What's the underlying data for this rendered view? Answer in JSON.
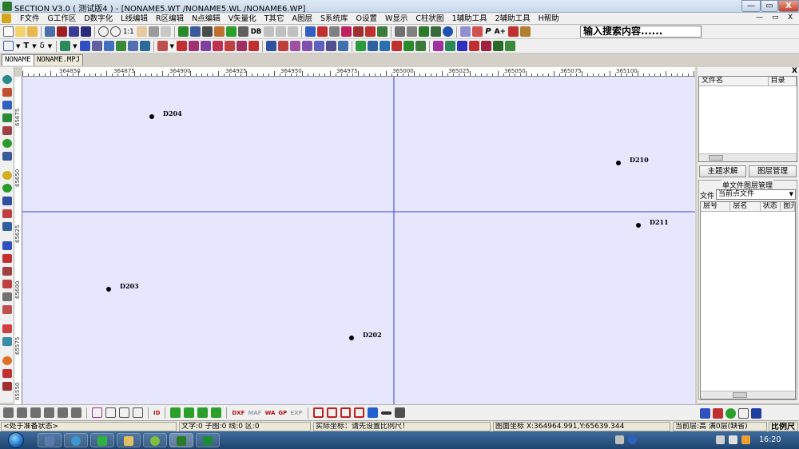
{
  "window": {
    "title": "SECTION V3.0 ( 测试版4 ) - [NONAME5.WT /NONAME5.WL /NONAME6.WP]",
    "min_label": "—",
    "max_label": "▭",
    "close_label": "X"
  },
  "menu": {
    "items": [
      "F文件",
      "G工作区",
      "D数字化",
      "L线编辑",
      "R区编辑",
      "N点编辑",
      "V矢量化",
      "T其它",
      "A图层",
      "S系统库",
      "O设置",
      "W显示",
      "C柱状图",
      "1辅助工具",
      "2辅助工具",
      "H帮助"
    ],
    "mdi_min": "—",
    "mdi_restore": "▭",
    "mdi_close": "X"
  },
  "toolbar1": {
    "zoom_label": "1:1",
    "db_label": "DB",
    "p_label": "P",
    "a_label": "A+",
    "search_value": "输入搜索内容......"
  },
  "toolbar2": {
    "t_label": "T",
    "delta_label": "δ"
  },
  "tabs": [
    "NONAME",
    "NONAME.MPJ"
  ],
  "ruler": {
    "top_ticks": [
      "364850",
      "364875",
      "364900",
      "364925",
      "364950",
      "364975",
      "365000",
      "365025",
      "365050",
      "365075",
      "365100"
    ],
    "left_ticks": [
      "65675",
      "65650",
      "65625",
      "65600",
      "65575",
      "65550"
    ]
  },
  "points": [
    {
      "label": "D204"
    },
    {
      "label": "D210"
    },
    {
      "label": "D211"
    },
    {
      "label": "D203"
    },
    {
      "label": "D202"
    }
  ],
  "right_panel": {
    "file_col": "文件名",
    "dir_col": "目录",
    "close_label": "X",
    "topic_button": "主题求解",
    "layer_button": "图层管理",
    "group_title": "单文件图层管理",
    "file_label": "文件",
    "file_select": "当前点文件",
    "layer_cols": [
      "层号",
      "层名",
      "状态",
      "图元"
    ]
  },
  "bottom_toolbar": {
    "id_label": "ID",
    "dxf_label": "DXF",
    "maf_label": "MAF",
    "wa_label": "WA",
    "gp_label": "GP",
    "exp_label": "EXP"
  },
  "status": {
    "state": "<处于准备状态>",
    "counts": "文字:0 子图:0 线:0 区:0",
    "real_coord": "实际坐标：请先设置比例尺！",
    "map_coord": "图面坐标 X:364964.991,Y:65639.344",
    "layer_info": "当前层:高 满0层(缺省)",
    "scale_label": "比例尺"
  },
  "taskbar": {
    "time": "16:20"
  },
  "colors": {
    "canvas_bg": "#e6e6ff",
    "crosshair": "#3c3cdc",
    "point": "#000000"
  }
}
